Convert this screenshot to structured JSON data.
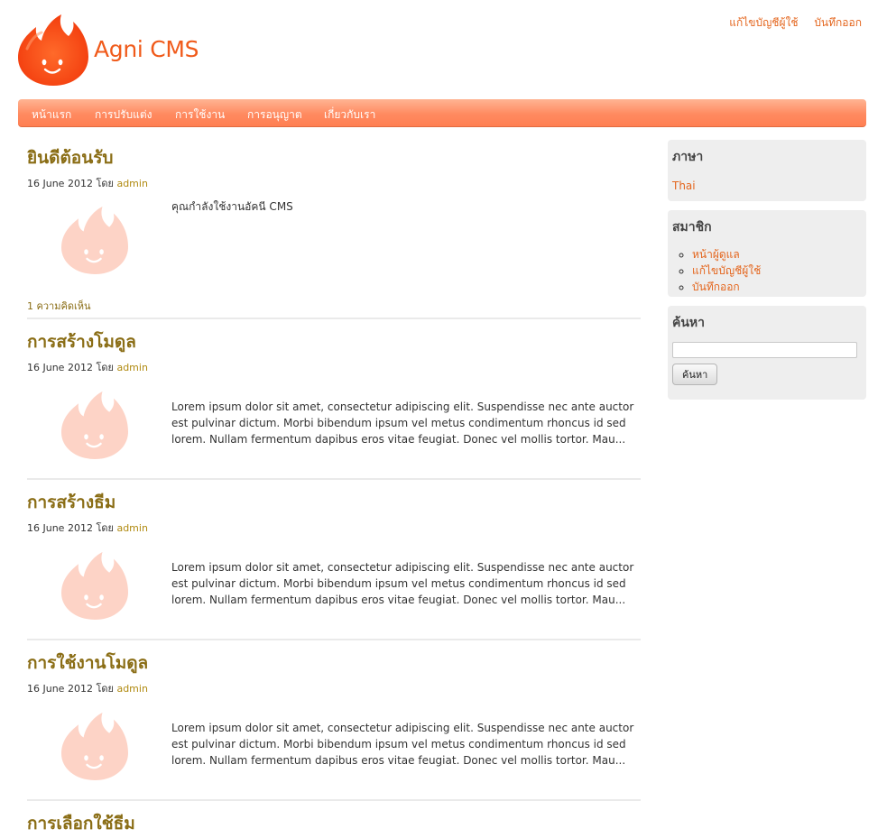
{
  "site": {
    "title": "Agni CMS"
  },
  "top_links": [
    "แก้ไขบัญชีผู้ใช้",
    "บันทึกออก"
  ],
  "nav": [
    "หน้าแรก",
    "การปรับแต่ง",
    "การใช้งาน",
    "การอนุญาต",
    "เกี่ยวกับเรา"
  ],
  "posts": [
    {
      "title": "ยินดีต้อนรับ",
      "date": "16 June 2012",
      "by": "โดย",
      "author": "admin",
      "excerpt": "คุณกำลังใช้งานอัคนี CMS",
      "comments": "1 ความคิดเห็น"
    },
    {
      "title": "การสร้างโมดูล",
      "date": "16 June 2012",
      "by": "โดย",
      "author": "admin",
      "excerpt": "Lorem ipsum dolor sit amet, consectetur adipiscing elit. Suspendisse nec ante auctor est pulvinar dictum. Morbi bibendum ipsum vel metus condimentum rhoncus id sed lorem. Nullam fermentum dapibus eros vitae feugiat. Donec vel mollis tortor. Mau...",
      "comments": ""
    },
    {
      "title": "การสร้างธีม",
      "date": "16 June 2012",
      "by": "โดย",
      "author": "admin",
      "excerpt": "Lorem ipsum dolor sit amet, consectetur adipiscing elit. Suspendisse nec ante auctor est pulvinar dictum. Morbi bibendum ipsum vel metus condimentum rhoncus id sed lorem. Nullam fermentum dapibus eros vitae feugiat. Donec vel mollis tortor. Mau...",
      "comments": ""
    },
    {
      "title": "การใช้งานโมดูล",
      "date": "16 June 2012",
      "by": "โดย",
      "author": "admin",
      "excerpt": "Lorem ipsum dolor sit amet, consectetur adipiscing elit. Suspendisse nec ante auctor est pulvinar dictum. Morbi bibendum ipsum vel metus condimentum rhoncus id sed lorem. Nullam fermentum dapibus eros vitae feugiat. Donec vel mollis tortor. Mau...",
      "comments": ""
    },
    {
      "title": "การเลือกใช้ธีม",
      "date": "",
      "by": "",
      "author": "",
      "excerpt": "",
      "comments": ""
    }
  ],
  "sidebar": {
    "language": {
      "title": "ภาษา",
      "value": "Thai"
    },
    "member": {
      "title": "สมาชิก",
      "links": [
        "หน้าผู้ดูแล",
        "แก้ไขบัญชีผู้ใช้",
        "บันทึกออก"
      ]
    },
    "search": {
      "title": "ค้นหา",
      "button": "ค้นหา",
      "value": ""
    }
  },
  "colors": {
    "accent": "#f05a1a",
    "nav_bg": "#ff8a60",
    "post_title": "#8a6d15",
    "link": "#e4661e"
  }
}
